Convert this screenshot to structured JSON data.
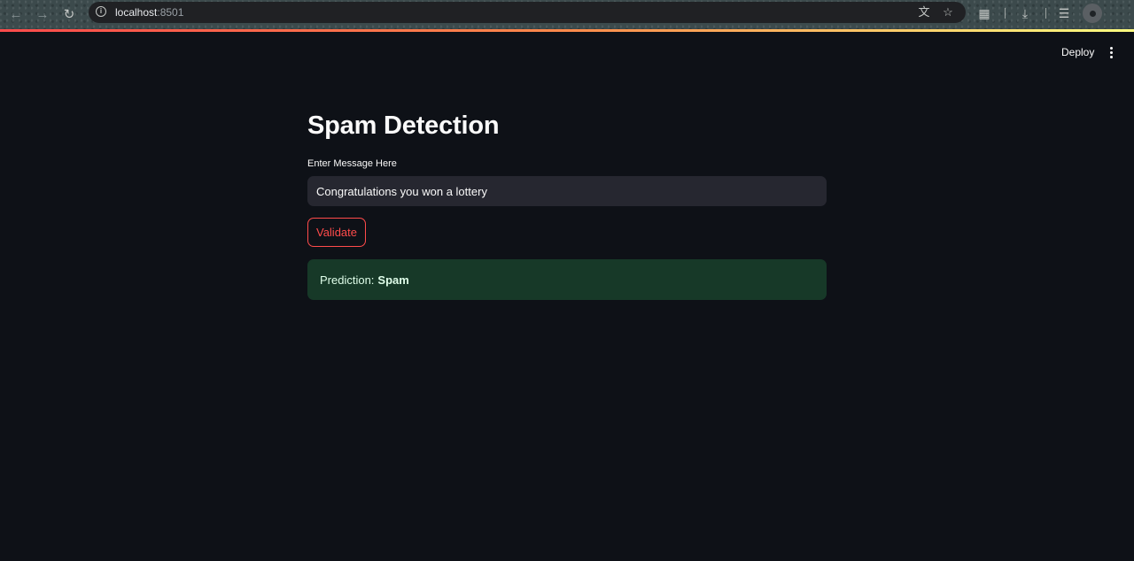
{
  "browser": {
    "url_host": "localhost",
    "url_port": ":8501"
  },
  "header": {
    "deploy_label": "Deploy"
  },
  "main": {
    "title": "Spam Detection",
    "input_label": "Enter Message Here",
    "input_value": "Congratulations you won a lottery",
    "button_label": "Validate",
    "result_prefix": "Prediction:",
    "result_value": "Spam"
  },
  "colors": {
    "background": "#0e1117",
    "accent": "#ff4b4b",
    "success_bg": "#173928"
  },
  "icons": [
    "back-arrow-icon",
    "forward-arrow-icon",
    "reload-icon",
    "info-icon",
    "translate-icon",
    "star-icon",
    "extensions-icon",
    "download-icon",
    "reading-list-icon",
    "profile-avatar",
    "kebab-menu-icon"
  ]
}
